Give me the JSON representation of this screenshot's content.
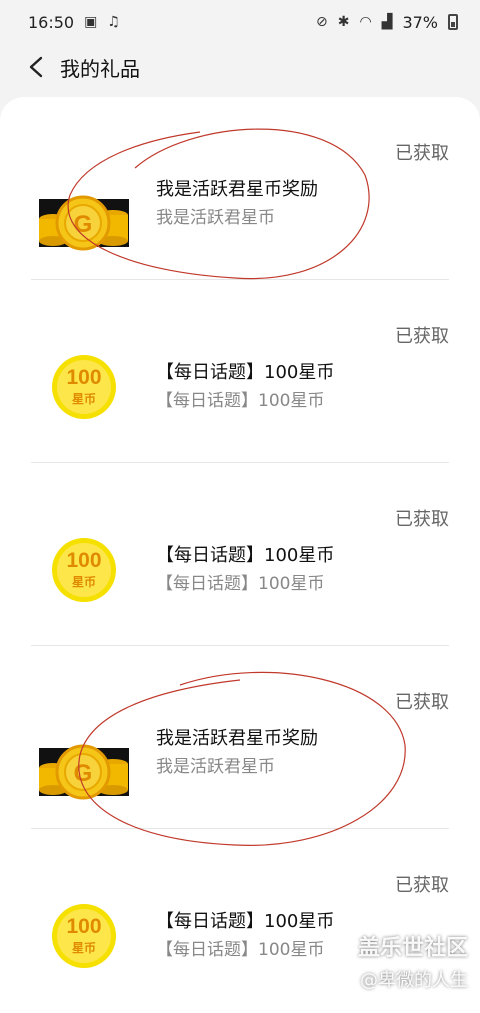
{
  "status_bar": {
    "time": "16:50",
    "battery": "37%"
  },
  "header": {
    "title": "我的礼品"
  },
  "gifts": [
    {
      "status": "已获取",
      "title": "我是活跃君星币奖励",
      "subtitle": "我是活跃君星币",
      "icon": "gold-coin-stack-icon"
    },
    {
      "status": "已获取",
      "title": "【每日话题】100星币",
      "subtitle": "【每日话题】100星币",
      "icon": "star-coin-100-icon"
    },
    {
      "status": "已获取",
      "title": "【每日话题】100星币",
      "subtitle": "【每日话题】100星币",
      "icon": "star-coin-100-icon"
    },
    {
      "status": "已获取",
      "title": "我是活跃君星币奖励",
      "subtitle": "我是活跃君星币",
      "icon": "gold-coin-stack-icon"
    },
    {
      "status": "已获取",
      "title": "【每日话题】100星币",
      "subtitle": "【每日话题】100星币",
      "icon": "star-coin-100-icon"
    }
  ],
  "coin_badge": {
    "amount": "100",
    "unit": "星币"
  },
  "watermark": {
    "line1": "盖乐世社区",
    "line2": "@卑微的人生"
  },
  "colors": {
    "coin_gold": "#f5c518",
    "coin_orange": "#e08a00",
    "annotation_red": "#c0392b"
  }
}
